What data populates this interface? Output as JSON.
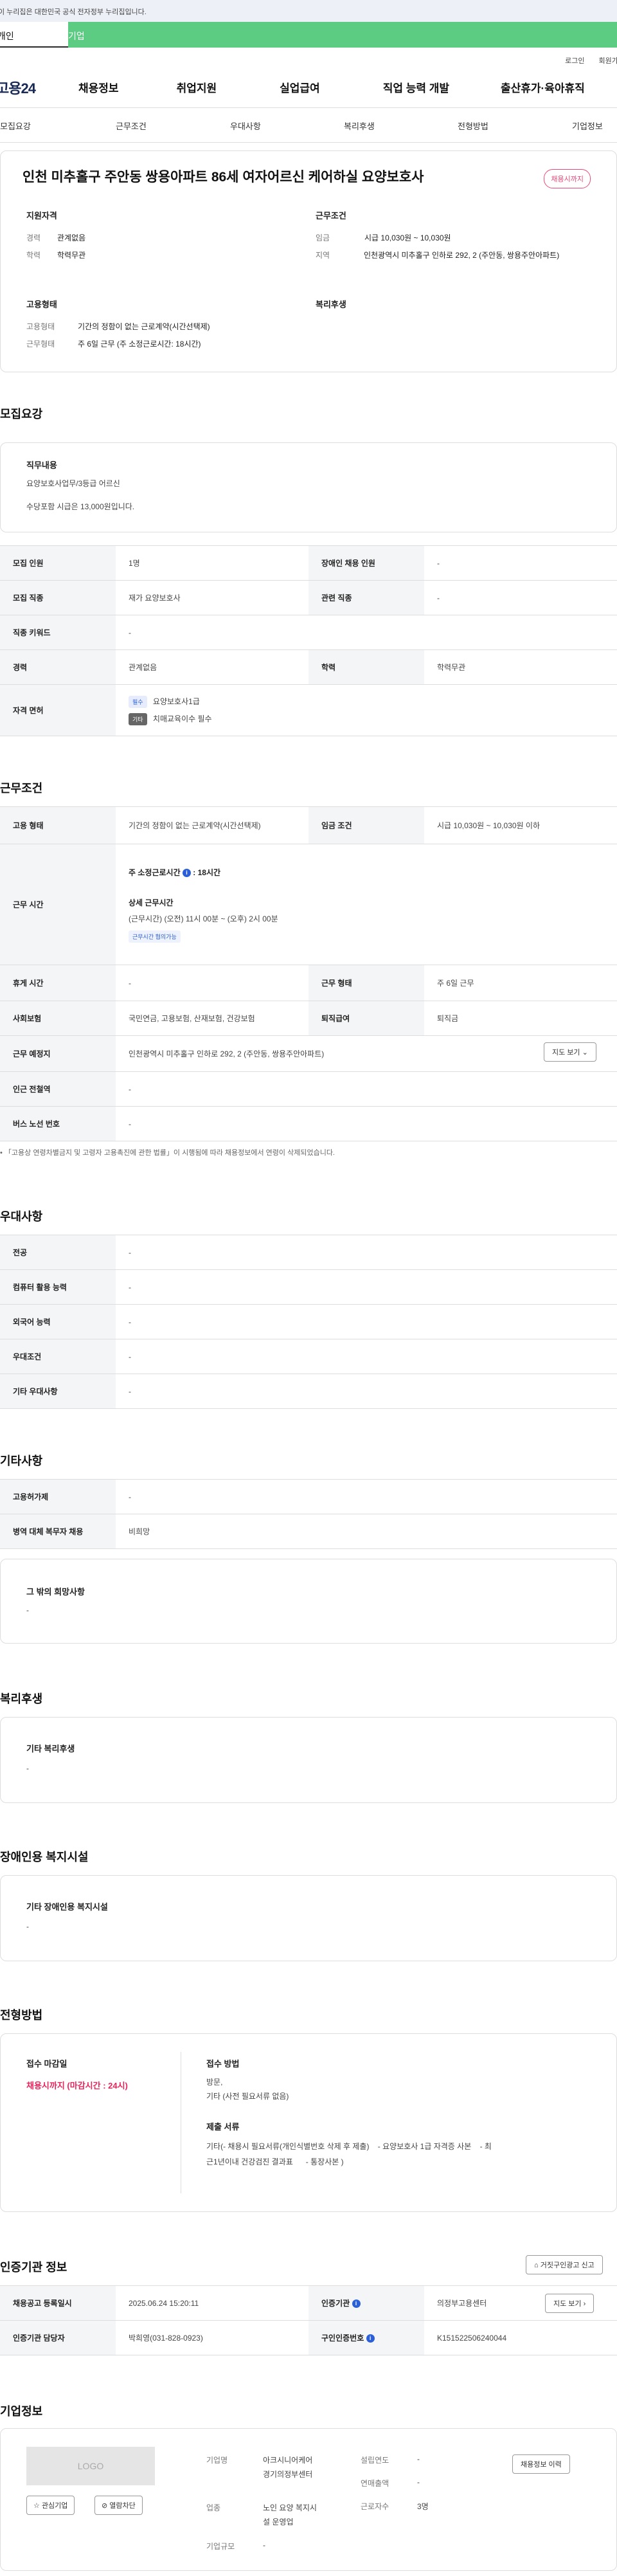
{
  "gov_notice": "이 누리집은 대한민국 공식 전자정부 누리집입니다.",
  "user_tabs": [
    "개인",
    "기업"
  ],
  "top_links": [
    "로그인",
    "회원가입"
  ],
  "logo": "고용24",
  "gnb": [
    "채용정보",
    "취업지원",
    "실업급여",
    "직업 능력 개발",
    "출산휴가·육아휴직"
  ],
  "section_tabs": [
    "모집요강",
    "근무조건",
    "우대사항",
    "복리후생",
    "전형방법",
    "기업정보"
  ],
  "job": {
    "title": "인천 미추홀구 주안동 쌍용아파트 86세 여자어르신 케어하실 요양보호사",
    "badge": "채용시까지",
    "qual_title": "지원자격",
    "qual": [
      {
        "k": "경력",
        "v": "관계없음"
      },
      {
        "k": "학력",
        "v": "학력무관"
      }
    ],
    "emp_title": "고용형태",
    "emp": [
      {
        "k": "고용형태",
        "v": "기간의 정함이 없는 근로계약(시간선택제)"
      },
      {
        "k": "근무형태",
        "v": "주 6일 근무 (주 소정근로시간: 18시간)"
      }
    ],
    "cond_title": "근무조건",
    "cond": [
      {
        "k": "임금",
        "v": "시급 10,030원 ~ 10,030원"
      },
      {
        "k": "지역",
        "v": "인천광역시 미추홀구 인하로 292, 2 (주안동, 쌍용주안아파트)"
      }
    ],
    "welfare_title": "복리후생"
  },
  "recruit": {
    "heading": "모집요강",
    "duty_title": "직무내용",
    "duty_lines": [
      "요양보호사업무/3등급 어르신",
      "수당포함 시급은 13,000원입니다."
    ],
    "rows": [
      {
        "h1": "모집 인원",
        "v1": "1명",
        "h2": "장애인 채용 인원",
        "v2": "-"
      },
      {
        "h1": "모집 직종",
        "v1": "재가 요양보호사",
        "h2": "관련 직종",
        "v2": "-"
      },
      {
        "h1": "직종 키워드",
        "v1": "-"
      },
      {
        "h1": "경력",
        "v1": "관계없음",
        "h2": "학력",
        "v2": "학력무관"
      }
    ],
    "license_h": "자격 면허",
    "licenses": [
      {
        "tag": "필수",
        "name": "요양보호사1급"
      },
      {
        "tag": "기타",
        "name": "치매교육이수 필수"
      }
    ]
  },
  "work": {
    "heading": "근무조건",
    "emp_h": "고용 형태",
    "emp_v": "기간의 정함이 없는 근로계약(시간선택제)",
    "wage_h": "임금 조건",
    "wage_v": "시급 10,030원 ~ 10,030원 이하",
    "time_h": "근무 시간",
    "weekly": "주 소정근로시간 ",
    "weekly_val": ": 18시간",
    "detail_t": "상세 근무시간",
    "detail_v": "(근무시간) (오전) 11시 00분 ~ (오후) 2시 00분",
    "adjust": "근무시간 협의가능",
    "rest_h": "휴게 시간",
    "rest_v": "-",
    "form_h": "근무 형태",
    "form_v": "주 6일 근무",
    "ins_h": "사회보험",
    "ins_v": "국민연금, 고용보험, 산재보험, 건강보험",
    "sev_h": "퇴직급여",
    "sev_v": "퇴직금",
    "loc_h": "근무 예정지",
    "loc_v": "인천광역시 미추홀구 인하로 292, 2 (주안동, 쌍용주안아파트)",
    "map_btn": "지도 보기",
    "sub_h": "인근 전철역",
    "sub_v": "-",
    "bus_h": "버스 노선 번호",
    "bus_v": "-",
    "note": "「고용상 연령차별금지 및 고령자 고용촉진에 관한 법률」이 시행됨에 따라 채용정보에서 연령이 삭제되었습니다."
  },
  "pref": {
    "heading": "우대사항",
    "rows": [
      {
        "h": "전공",
        "v": "-"
      },
      {
        "h": "컴퓨터 활용 능력",
        "v": "-"
      },
      {
        "h": "외국어 능력",
        "v": "-"
      },
      {
        "h": "우대조건",
        "v": "-"
      },
      {
        "h": "기타 우대사항",
        "v": "-"
      }
    ]
  },
  "etc": {
    "heading": "기타사항",
    "rows": [
      {
        "h": "고용허가제",
        "v": "-"
      },
      {
        "h": "병역 대체 복무자 채용",
        "v": "비희망"
      }
    ],
    "other_t": "그 밖의 희망사항",
    "other_v": "-"
  },
  "welfare": {
    "heading": "복리후생",
    "t": "기타 복리후생",
    "v": "-"
  },
  "disabled": {
    "heading": "장애인용 복지시설",
    "t": "기타 장애인용 복지시설",
    "v": "-"
  },
  "selection": {
    "heading": "전형방법",
    "deadline_t": "접수 마감일",
    "deadline_v": "채용시까지 (마감시간 : 24시)",
    "method_t": "접수 방법",
    "method_lines": [
      "방문,",
      "기타 (사전 필요서류 없음)"
    ],
    "docs_t": "제출 서류",
    "docs_lines": [
      "기타(- 채용시 필요서류(개인식별번호 삭제 후 제출)    - 요양보호사 1급 자격증 사본    - 최",
      "근1년이내 건강검진 결과표      - 통장사본 )"
    ]
  },
  "agency": {
    "heading": "인증기관 정보",
    "report_btn": "거짓구인광고 신고",
    "reg_h": "채용공고 등록일시",
    "reg_v": "2025.06.24 15:20:11",
    "org_h": "인증기관",
    "org_v": "의정부고용센터",
    "map_btn": "지도 보기",
    "mgr_h": "인증기관 담당자",
    "mgr_v": "박희영(031-828-0923)",
    "no_h": "구인인증번호",
    "no_v": "K151522506240044"
  },
  "company": {
    "heading": "기업정보",
    "logo": "LOGO",
    "fav_btn": "관심기업",
    "block_btn": "열람차단",
    "name_k": "기업명",
    "name_v1": "아크시니어케어",
    "name_v2": "경기의정부센터",
    "ind_k": "업종",
    "ind_v1": "노인 요양 복지시",
    "ind_v2": "설 운영업",
    "size_k": "기업규모",
    "size_v": "-",
    "est_k": "설립연도",
    "est_v": "-",
    "rev_k": "연매출액",
    "rev_v": "-",
    "emp_k": "근로자수",
    "emp_v": "3명",
    "more_btn": "채용정보 이력"
  },
  "colors": {
    "accent": "#5ccc83",
    "badge": "#e84a78",
    "deadline": "#e8245c",
    "info": "#2b5fd9"
  }
}
